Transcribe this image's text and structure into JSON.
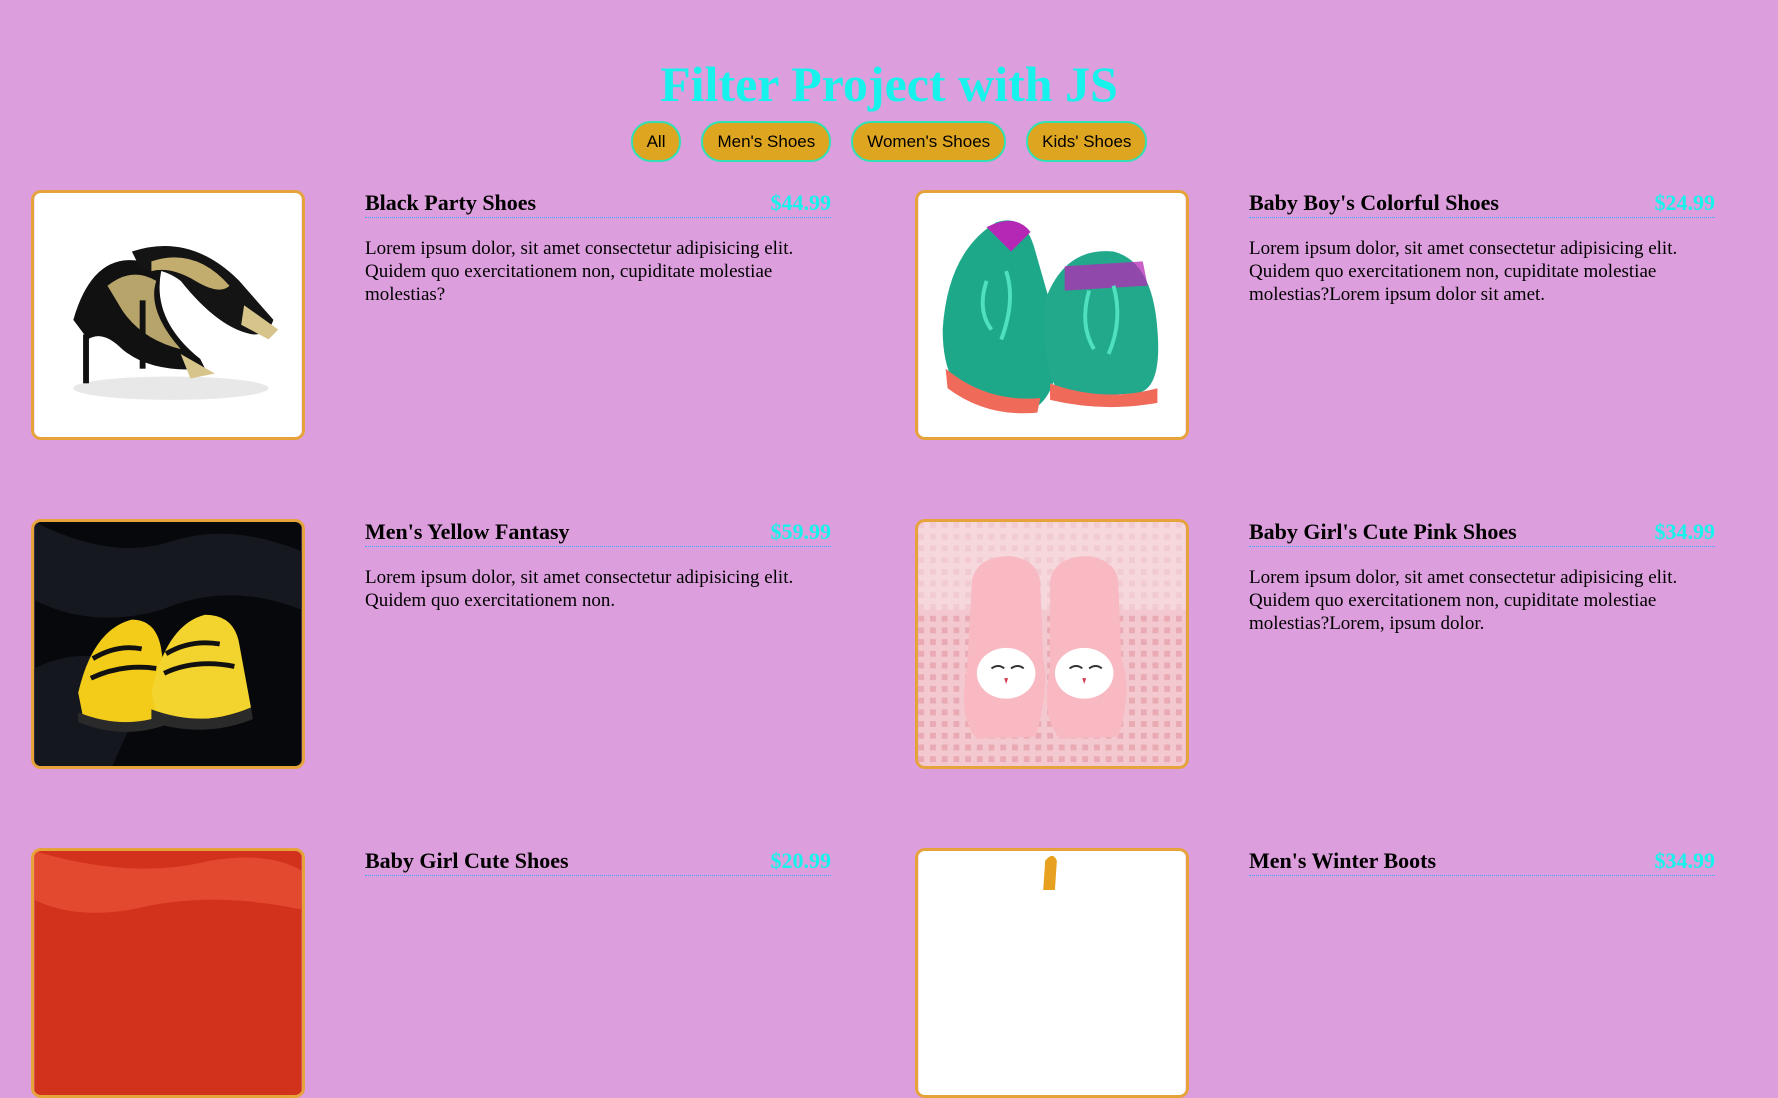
{
  "header": {
    "title": "Filter Project with JS"
  },
  "filters": [
    {
      "label": "All"
    },
    {
      "label": "Men's Shoes"
    },
    {
      "label": "Women's Shoes"
    },
    {
      "label": "Kids' Shoes"
    }
  ],
  "items": [
    {
      "title": "Black Party Shoes",
      "price": "$44.99",
      "desc": "Lorem ipsum dolor, sit amet consectetur adipisicing elit. Quidem quo exercitationem non, cupiditate molestiae molestias?",
      "image_icon": "black-heels-image"
    },
    {
      "title": "Baby Boy's Colorful Shoes",
      "price": "$24.99",
      "desc": "Lorem ipsum dolor, sit amet consectetur adipisicing elit. Quidem quo exercitationem non, cupiditate molestiae molestias?Lorem ipsum dolor sit amet.",
      "image_icon": "green-baby-shoes-image"
    },
    {
      "title": "Men's Yellow Fantasy",
      "price": "$59.99",
      "desc": "Lorem ipsum dolor, sit amet consectetur adipisicing elit. Quidem quo exercitationem non.",
      "image_icon": "yellow-sneakers-image"
    },
    {
      "title": "Baby Girl's Cute Pink Shoes",
      "price": "$34.99",
      "desc": "Lorem ipsum dolor, sit amet consectetur adipisicing elit. Quidem quo exercitationem non, cupiditate molestiae molestias?Lorem, ipsum dolor.",
      "image_icon": "pink-booties-image"
    },
    {
      "title": "Baby Girl Cute Shoes",
      "price": "$20.99",
      "desc": "",
      "image_icon": "red-shoes-image"
    },
    {
      "title": "Men's Winter Boots",
      "price": "$34.99",
      "desc": "",
      "image_icon": "winter-boots-image"
    }
  ],
  "colors": {
    "background": "#dc9edc",
    "title": "#18f2ec",
    "button_fill": "#dea521",
    "button_border": "#31e0b4",
    "image_border": "#e6a33a",
    "price": "#18f2ec"
  }
}
